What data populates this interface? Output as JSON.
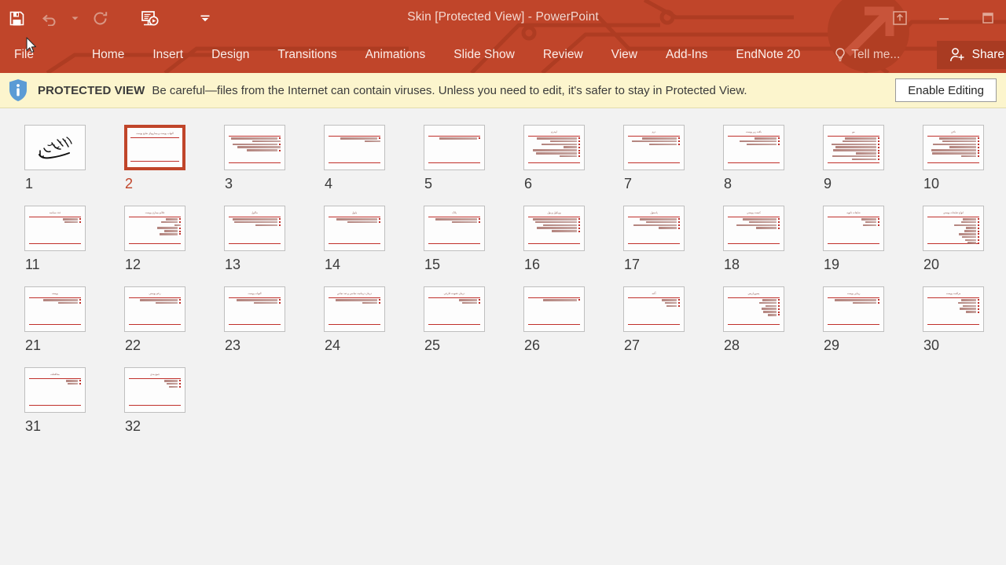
{
  "window": {
    "title": "Skin [Protected View] - PowerPoint",
    "quick_access": [
      {
        "name": "save",
        "label": "Save",
        "state": "enabled"
      },
      {
        "name": "undo",
        "label": "Undo",
        "state": "disabled"
      },
      {
        "name": "undo-dropdown",
        "label": "Undo options",
        "state": "disabled"
      },
      {
        "name": "redo",
        "label": "Repeat",
        "state": "disabled"
      },
      {
        "name": "start-slideshow",
        "label": "Start From Beginning",
        "state": "enabled"
      },
      {
        "name": "customize-qat",
        "label": "Customize Quick Access Toolbar",
        "state": "enabled"
      }
    ],
    "controls": [
      {
        "name": "ribbon-display-options",
        "label": "Ribbon Display Options"
      },
      {
        "name": "minimize",
        "label": "Minimize"
      },
      {
        "name": "restore",
        "label": "Restore Down"
      }
    ],
    "accent_color": "#C0452A",
    "share_bg": "#A93B22"
  },
  "ribbon": {
    "tabs": [
      {
        "label": "File",
        "active": false
      },
      {
        "label": "Home",
        "active": false
      },
      {
        "label": "Insert",
        "active": false
      },
      {
        "label": "Design",
        "active": false
      },
      {
        "label": "Transitions",
        "active": false
      },
      {
        "label": "Animations",
        "active": false
      },
      {
        "label": "Slide Show",
        "active": false
      },
      {
        "label": "Review",
        "active": false
      },
      {
        "label": "View",
        "active": false
      },
      {
        "label": "Add-Ins",
        "active": false
      },
      {
        "label": "EndNote 20",
        "active": false
      }
    ],
    "tell_me": "Tell me...",
    "share": "Share"
  },
  "protected_view": {
    "badge": "PROTECTED VIEW",
    "message": "Be careful—files from the Internet can contain viruses. Unless you need to edit, it's safer to stay in Protected View.",
    "button": "Enable Editing",
    "bg": "#FCF5CD"
  },
  "slide_sorter": {
    "selected_index": 2,
    "slides": [
      {
        "num": "1",
        "kind": "bismillah",
        "title": "",
        "lines": []
      },
      {
        "num": "2",
        "kind": "title-only",
        "title": "التهاب پوست و بیماریهای شایع پوست",
        "lines": []
      },
      {
        "num": "3",
        "kind": "content",
        "title": "",
        "lines": [
          90,
          55,
          88,
          84,
          60
        ]
      },
      {
        "num": "4",
        "kind": "content",
        "title": "",
        "lines": [
          72,
          30
        ]
      },
      {
        "num": "5",
        "kind": "content",
        "title": "",
        "lines": [
          74
        ]
      },
      {
        "num": "6",
        "kind": "titled",
        "title": "اپیدرم",
        "lines": [
          78,
          52,
          70,
          26,
          86,
          80,
          34
        ]
      },
      {
        "num": "7",
        "kind": "titled",
        "title": "درم",
        "lines": [
          68,
          88,
          54
        ]
      },
      {
        "num": "8",
        "kind": "titled",
        "title": "بافت زیر پوست",
        "lines": [
          44,
          72,
          58
        ]
      },
      {
        "num": "9",
        "kind": "titled",
        "title": "مو",
        "lines": [
          62,
          66,
          88,
          80,
          84,
          40,
          86,
          48
        ]
      },
      {
        "num": "10",
        "kind": "titled",
        "title": "ناخن",
        "lines": [
          72,
          66,
          84,
          52,
          88,
          86,
          30
        ]
      },
      {
        "num": "11",
        "kind": "titled",
        "title": "غدد سباسه",
        "lines": [
          30,
          26
        ]
      },
      {
        "num": "12",
        "kind": "titled",
        "title": "علائم بیماری پوست",
        "lines": [
          24,
          32,
          12,
          40,
          26,
          36
        ]
      },
      {
        "num": "13",
        "kind": "titled",
        "title": "ماکول",
        "lines": [
          88,
          84,
          44
        ]
      },
      {
        "num": "14",
        "kind": "titled",
        "title": "پاپول",
        "lines": [
          80,
          58
        ]
      },
      {
        "num": "15",
        "kind": "titled",
        "title": "پلاک",
        "lines": [
          82,
          50
        ]
      },
      {
        "num": "16",
        "kind": "titled",
        "title": "وزیکول و بول",
        "lines": [
          86,
          82,
          66,
          78,
          50
        ]
      },
      {
        "num": "17",
        "kind": "titled",
        "title": "پاستول",
        "lines": [
          72,
          60,
          84,
          36
        ]
      },
      {
        "num": "18",
        "kind": "titled",
        "title": "کیست پوستی",
        "lines": [
          66,
          54,
          78,
          40
        ]
      },
      {
        "num": "19",
        "kind": "titled",
        "title": "ضایعات ثانویه",
        "lines": [
          30,
          22,
          26
        ]
      },
      {
        "num": "20",
        "kind": "titled",
        "title": "انواع ضایعات پوستی",
        "lines": [
          26,
          30,
          44,
          20,
          24,
          34,
          28,
          22,
          18
        ]
      },
      {
        "num": "21",
        "kind": "titled",
        "title": "پوسته",
        "lines": [
          68,
          38
        ]
      },
      {
        "num": "22",
        "kind": "titled",
        "title": "زخم پوستی",
        "lines": [
          74,
          44
        ]
      },
      {
        "num": "23",
        "kind": "titled",
        "title": "التهاب پوست",
        "lines": [
          80,
          46
        ]
      },
      {
        "num": "24",
        "kind": "titled",
        "title": "درمان درماتیت تماسی و ضد تماس",
        "lines": [
          82,
          30
        ]
      },
      {
        "num": "25",
        "kind": "titled",
        "title": "درمان عفونت قارچی",
        "lines": [
          36,
          30
        ]
      },
      {
        "num": "26",
        "kind": "titled",
        "title": "",
        "lines": [
          66
        ]
      },
      {
        "num": "27",
        "kind": "titled",
        "title": "آکنه",
        "lines": [
          30,
          24,
          20
        ]
      },
      {
        "num": "28",
        "kind": "titled",
        "title": "پسوریازیس",
        "lines": [
          28,
          34,
          22,
          30,
          26,
          18
        ]
      },
      {
        "num": "29",
        "kind": "titled",
        "title": "زیبایی پوست",
        "lines": [
          82,
          46
        ]
      },
      {
        "num": "30",
        "kind": "titled",
        "title": "مراقبت پوست",
        "lines": [
          30,
          36,
          26,
          32,
          20
        ]
      },
      {
        "num": "31",
        "kind": "titled",
        "title": "محافظت",
        "lines": [
          24,
          20
        ]
      },
      {
        "num": "32",
        "kind": "titled",
        "title": "جمع بندی",
        "lines": [
          26,
          22,
          18
        ]
      }
    ]
  }
}
